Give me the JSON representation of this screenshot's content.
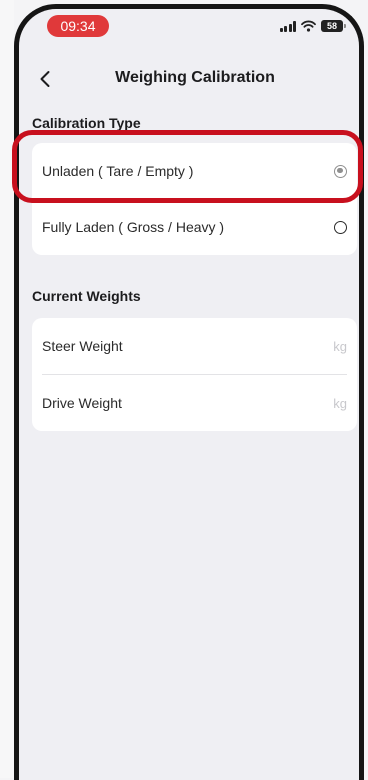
{
  "status_bar": {
    "time": "09:34",
    "battery": "58"
  },
  "nav": {
    "title": "Weighing Calibration"
  },
  "calibration": {
    "section_title": "Calibration Type",
    "options": [
      {
        "label": "Unladen ( Tare / Empty )",
        "selected": true
      },
      {
        "label": "Fully Laden ( Gross / Heavy )",
        "selected": false
      }
    ]
  },
  "weights": {
    "section_title": "Current Weights",
    "fields": [
      {
        "label": "Steer Weight",
        "unit": "kg"
      },
      {
        "label": "Drive Weight",
        "unit": "kg"
      }
    ]
  },
  "colors": {
    "time_pill": "#e0393a",
    "highlight": "#c8101e",
    "selected_radio": "#8f8f8f"
  }
}
